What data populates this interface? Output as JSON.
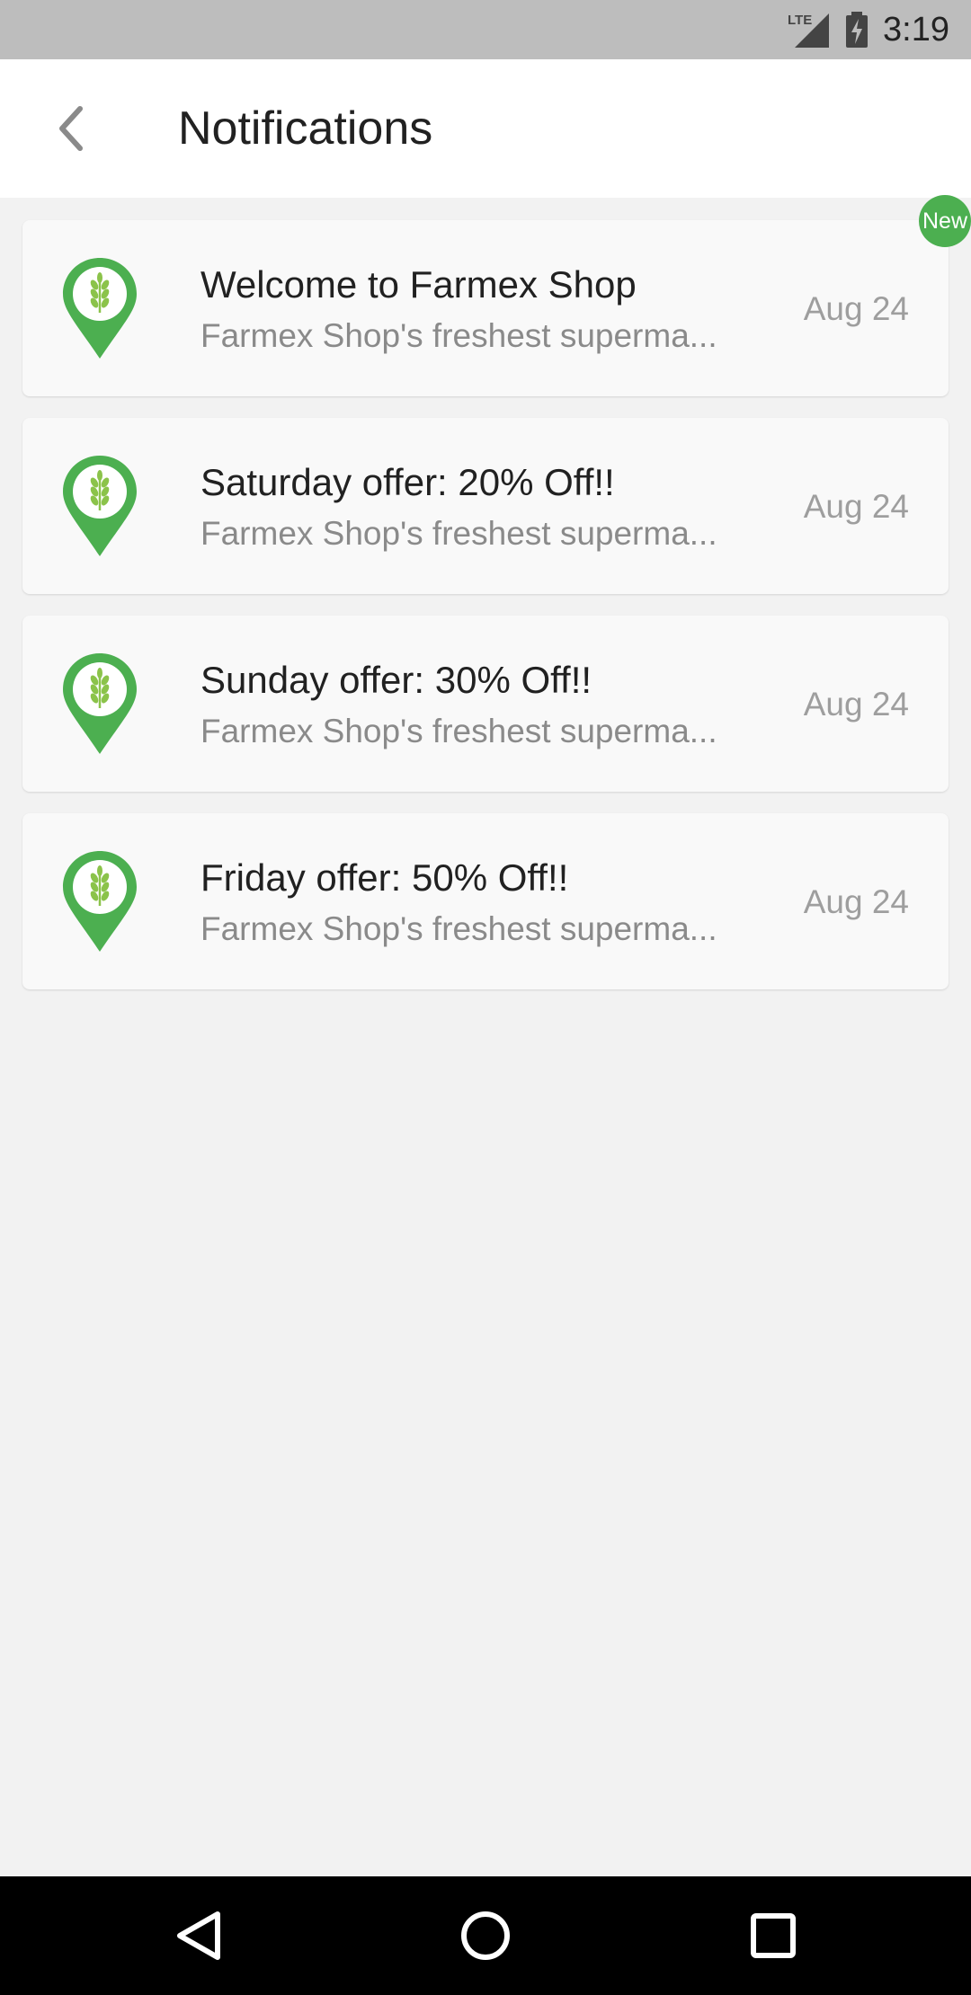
{
  "status_bar": {
    "network": "LTE",
    "time": "3:19"
  },
  "header": {
    "back_icon": "chevron-left-icon",
    "title": "Notifications"
  },
  "notifications": [
    {
      "title": "Welcome to Farmex Shop",
      "subtitle": "Farmex Shop's freshest superma...",
      "date": "Aug 24",
      "badge": "New",
      "icon": "farm-location-pin-icon"
    },
    {
      "title": "Saturday offer: 20% Off!!",
      "subtitle": "Farmex Shop's freshest superma...",
      "date": "Aug 24",
      "icon": "farm-location-pin-icon"
    },
    {
      "title": "Sunday offer: 30% Off!!",
      "subtitle": "Farmex Shop's freshest superma...",
      "date": "Aug 24",
      "icon": "farm-location-pin-icon"
    },
    {
      "title": "Friday offer: 50% Off!!",
      "subtitle": "Farmex Shop's freshest superma...",
      "date": "Aug 24",
      "icon": "farm-location-pin-icon"
    }
  ],
  "nav_bar": {
    "back": "nav-back-triangle-icon",
    "home": "nav-home-circle-icon",
    "recents": "nav-recents-square-icon"
  },
  "colors": {
    "brand_green": "#4caf50",
    "leaf_green": "#8bc34a",
    "background": "#f2f2f2",
    "card": "#f9f9f9"
  }
}
